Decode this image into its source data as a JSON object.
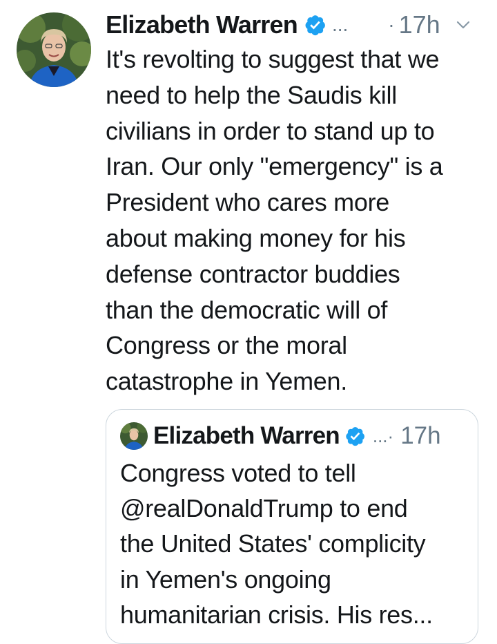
{
  "tweet": {
    "author_name": "Elizabeth Warren",
    "verified_icon": "verified-badge-icon",
    "more_indicator": "...",
    "separator": "·",
    "timestamp": "17h",
    "menu_icon": "chevron-down-icon",
    "text": "It's revolting to suggest that we\nneed to help the Saudis kill\ncivilians in order to stand up to\nIran. Our only \"emergency\" is a\nPresident who cares more\nabout making money for his\ndefense contractor buddies\nthan the democratic will of\nCongress or the moral\ncatastrophe in Yemen."
  },
  "quoted_tweet": {
    "author_name": "Elizabeth Warren",
    "verified_icon": "verified-badge-icon",
    "more_indicator": "...·",
    "timestamp": "17h",
    "text": "Congress voted to tell\n@realDonaldTrump to end\nthe United States' complicity\nin Yemen's ongoing\nhumanitarian crisis. His res..."
  },
  "colors": {
    "text": "#14171a",
    "secondary": "#657786",
    "verified": "#1da1f2",
    "border": "#ccd6dd"
  }
}
